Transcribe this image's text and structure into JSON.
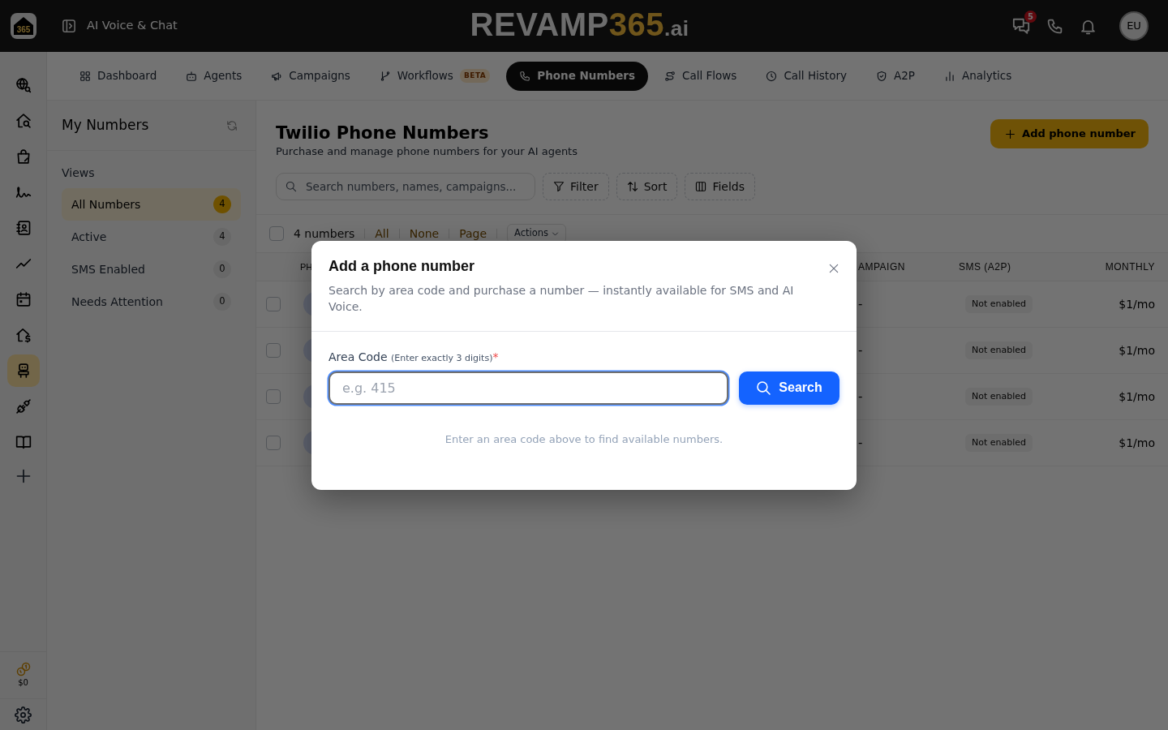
{
  "top_bar": {
    "logo_text": "365",
    "app_title": "AI Voice & Chat",
    "brand": {
      "name": "REVAMP",
      "number": "365",
      "suffix": ".ai"
    },
    "chat_badge": "5",
    "avatar_initials": "EU"
  },
  "rail": {
    "items": [
      {
        "selected": false
      },
      {
        "selected": false
      },
      {
        "selected": false
      },
      {
        "selected": false
      },
      {
        "selected": false
      },
      {
        "selected": false
      },
      {
        "selected": false
      },
      {
        "selected": false
      },
      {
        "selected": true
      },
      {
        "selected": false
      },
      {
        "selected": false
      }
    ],
    "credits": "$0"
  },
  "nav_tabs": [
    {
      "label": "Dashboard",
      "selected": false
    },
    {
      "label": "Agents",
      "selected": false
    },
    {
      "label": "Campaigns",
      "selected": false
    },
    {
      "label": "Workflows",
      "badge": "BETA",
      "selected": false
    },
    {
      "label": "Phone Numbers",
      "selected": true
    },
    {
      "label": "Call Flows",
      "selected": false
    },
    {
      "label": "Call History",
      "selected": false
    },
    {
      "label": "A2P",
      "selected": false
    },
    {
      "label": "Analytics",
      "selected": false
    }
  ],
  "views_panel": {
    "title": "My Numbers",
    "heading": "Views",
    "items": [
      {
        "label": "All Numbers",
        "count": "4",
        "selected": true
      },
      {
        "label": "Active",
        "count": "4",
        "selected": false
      },
      {
        "label": "SMS Enabled",
        "count": "0",
        "selected": false
      },
      {
        "label": "Needs Attention",
        "count": "0",
        "selected": false
      }
    ]
  },
  "page": {
    "title": "Twilio Phone Numbers",
    "subtitle": "Purchase and manage phone numbers for your AI agents",
    "add_button": "Add phone number",
    "search": {
      "placeholder": "Search numbers, names, campaigns..."
    },
    "tool_buttons": [
      "Filter",
      "Sort",
      "Fields"
    ],
    "selection_bar": {
      "checked": false,
      "count": "4 numbers",
      "links": [
        "All",
        "None",
        "Page"
      ],
      "actions": "Actions"
    },
    "table": {
      "columns": [
        "PH",
        "AMPAIGN",
        "SMS (A2P)",
        "MONTHLY"
      ],
      "rows": [
        {
          "checked": false,
          "campaign": "-",
          "sms_a2p": "Not enabled",
          "monthly": "$1/mo"
        },
        {
          "checked": false,
          "campaign": "-",
          "sms_a2p": "Not enabled",
          "monthly": "$1/mo"
        },
        {
          "checked": false,
          "campaign": "-",
          "sms_a2p": "Not enabled",
          "monthly": "$1/mo"
        },
        {
          "checked": false,
          "campaign": "-",
          "sms_a2p": "Not enabled",
          "monthly": "$1/mo"
        }
      ]
    }
  },
  "dialog": {
    "title": "Add a phone number",
    "description": "Search by area code and purchase a number — instantly available for SMS and AI Voice.",
    "field": {
      "label": "Area Code",
      "hint": "(Enter exactly 3 digits)",
      "required_mark": "*",
      "placeholder": "e.g. 415",
      "focused": true
    },
    "search_button": "Search",
    "empty_message": "Enter an area code above to find available numbers."
  }
}
